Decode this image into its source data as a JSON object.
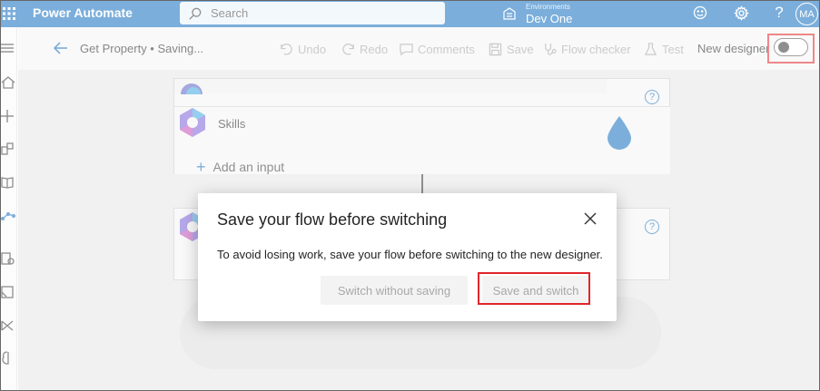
{
  "app": {
    "name": "Power Automate",
    "search_placeholder": "Search",
    "environment_label": "Environments",
    "environment_name": "Dev One",
    "avatar_initials": "MA"
  },
  "commandbar": {
    "flow_title": "Get Property • Saving...",
    "undo": "Undo",
    "redo": "Redo",
    "comments": "Comments",
    "save": "Save",
    "flow_checker": "Flow checker",
    "test": "Test",
    "new_designer_label": "New designer",
    "new_designer_enabled": false
  },
  "canvas": {
    "skills_card_title": "Skills",
    "add_input_label": "Add an input"
  },
  "dialog": {
    "title": "Save your flow before switching",
    "body": "To avoid losing work, save your flow before switching to the new designer.",
    "switch_without_saving": "Switch without saving",
    "save_and_switch": "Save and switch"
  },
  "icons": {
    "waffle": "waffle-icon",
    "search": "search-icon",
    "environment": "environment-icon",
    "smiley": "smiley-icon",
    "settings": "gear-icon",
    "help": "help-icon",
    "back": "back-arrow-icon",
    "close": "close-icon"
  },
  "colors": {
    "brand": "#0f6cbd",
    "highlight": "#e0262b",
    "disabled_text": "#a8a8a8"
  }
}
